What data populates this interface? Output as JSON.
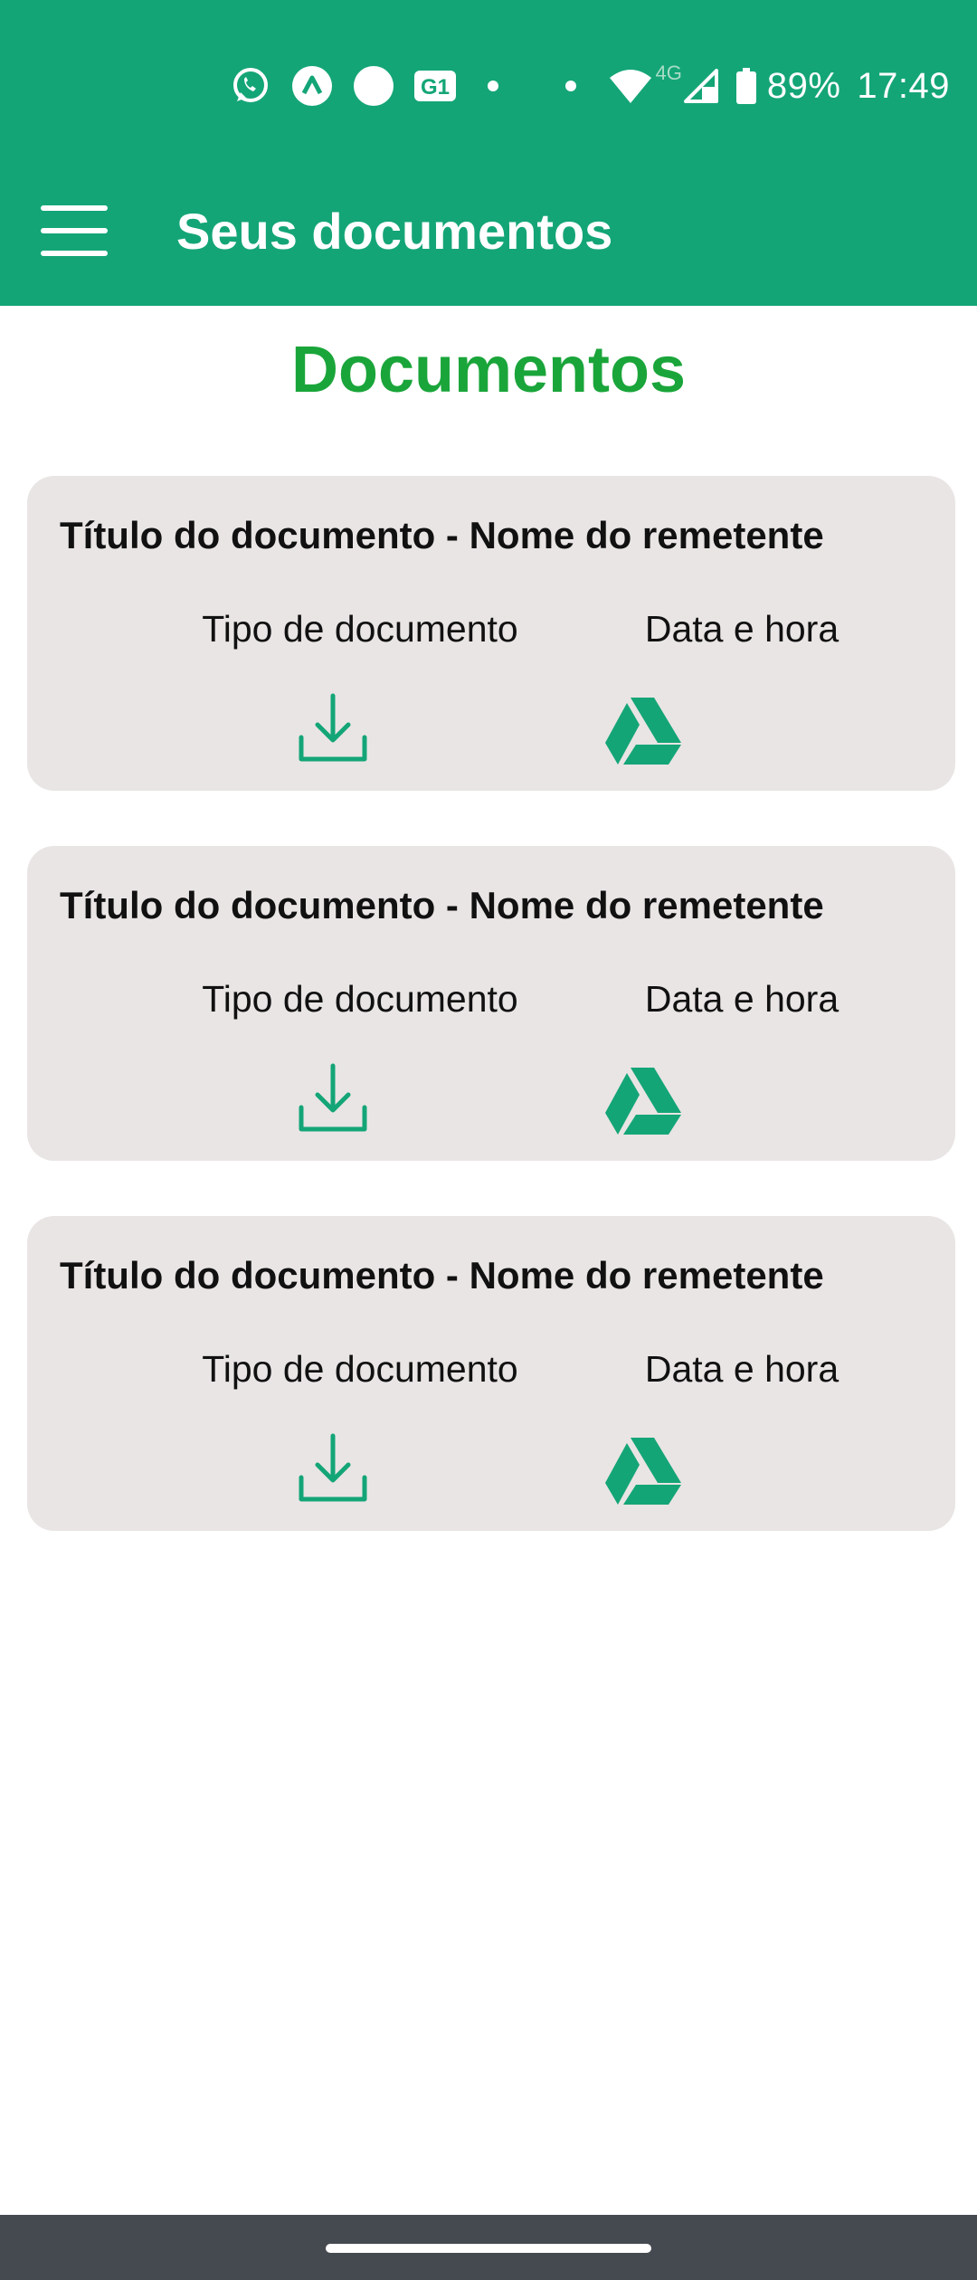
{
  "status_bar": {
    "network_label": "4G",
    "battery": "89%",
    "time": "17:49",
    "icons": [
      "whatsapp-icon",
      "notification-app-icon",
      "dot-app-icon",
      "g1-icon",
      "dot-icon",
      "dot-icon",
      "wifi-icon",
      "cell-signal-icon",
      "battery-icon"
    ]
  },
  "toolbar": {
    "title": "Seus documentos",
    "menu_icon": "hamburger-icon"
  },
  "page": {
    "heading": "Documentos"
  },
  "documents": [
    {
      "title": "Título do documento - Nome do remetente",
      "type": "Tipo de documento",
      "datetime": "Data e hora",
      "download_icon": "download-icon",
      "drive_icon": "google-drive-icon"
    },
    {
      "title": "Título do documento - Nome do remetente",
      "type": "Tipo de documento",
      "datetime": "Data e hora",
      "download_icon": "download-icon",
      "drive_icon": "google-drive-icon"
    },
    {
      "title": "Título do documento - Nome do remetente",
      "type": "Tipo de documento",
      "datetime": "Data e hora",
      "download_icon": "download-icon",
      "drive_icon": "google-drive-icon"
    }
  ],
  "colors": {
    "app_bar": "#14a577",
    "heading": "#1aa53a",
    "card_bg": "#e9e5e4",
    "icon_accent": "#14a577",
    "nav_bar": "#454a50"
  }
}
